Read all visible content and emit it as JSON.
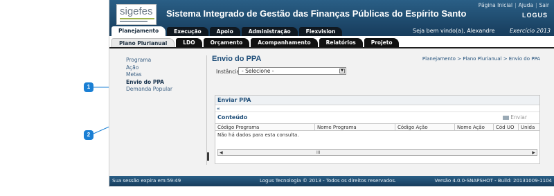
{
  "header": {
    "logo_text": "sigefes",
    "title": "Sistema Integrado de Gestão das Finanças Públicas do Espírito Santo",
    "links": [
      "Página Inicial",
      "Ajuda",
      "Sair"
    ],
    "brand": "LOGUS",
    "welcome": "Seja bem vindo(a), Alexandre",
    "exercise": "Exercício 2013"
  },
  "main_tabs": [
    "Planejamento",
    "Execução",
    "Apoio",
    "Administração",
    "Flexvision"
  ],
  "sub_tabs": [
    "Plano Plurianual",
    "LDO",
    "Orçamento",
    "Acompanhamento",
    "Relatórios",
    "Projeto"
  ],
  "menu": [
    "Programa",
    "Ação",
    "Metas",
    "Envio do PPA",
    "Demanda Popular"
  ],
  "content": {
    "title": "Envio do PPA",
    "breadcrumb": "Planejamento > Plano Plurianual > Envio do PPA",
    "instance_label": "Instância",
    "instance_value": "- Selecione -",
    "panel_title": "Enviar PPA",
    "collapse_symbol": "«",
    "section_title": "Conteúdo",
    "send_label": "Enviar",
    "columns": [
      "Código Programa",
      "Nome Programa",
      "Código Ação",
      "Nome Ação",
      "Cód UO",
      "Unida"
    ],
    "empty_message": "Não há dados para esta consulta.",
    "scroll_marker": "III"
  },
  "footer": {
    "session": "Sua sessão expira em:59:49",
    "copyright": "Logus Tecnologia © 2013 - Todos os direitos reservados.",
    "version": "Versão 4.0.0-SNAPSHOT - Build: 20131009-1104"
  },
  "callouts": [
    "1",
    "2"
  ],
  "colors": {
    "header": "#1f4e79",
    "accent": "#1a7fd4",
    "tab_dark": "#111111"
  }
}
